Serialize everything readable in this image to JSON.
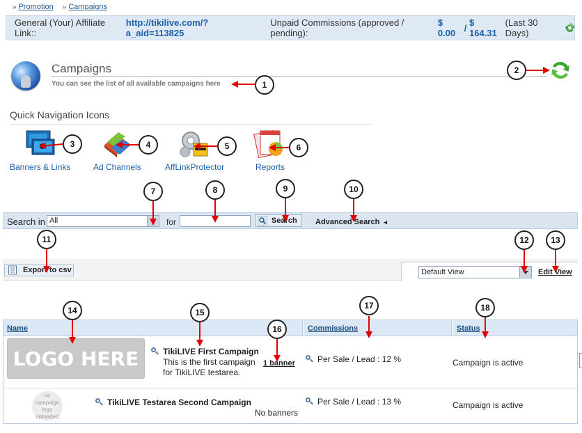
{
  "breadcrumb": [
    {
      "sep": "»",
      "label": "Promotion"
    },
    {
      "sep": "»",
      "label": "Campaigns"
    }
  ],
  "affiliate_bar": {
    "link_label": "General (Your) Affiliate Link::",
    "link_value": "http://tikilive.com/?a_aid=113825",
    "commissions_label": "Unpaid Commissions (approved / pending):",
    "approved": "$ 0.00",
    "divider": "/",
    "pending": "$ 164.31",
    "period": "(Last 30 Days)"
  },
  "section": {
    "title": "Campaigns",
    "subtitle": "You can see the list of all available campaigns here"
  },
  "quick_nav": {
    "title": "Quick Navigation Icons",
    "items": [
      {
        "label": "Banners & Links",
        "icon": "banners-links-icon"
      },
      {
        "label": "Ad Channels",
        "icon": "ad-channels-icon"
      },
      {
        "label": "AffLinkProtector",
        "icon": "afflinkprotector-icon"
      },
      {
        "label": "Reports",
        "icon": "reports-icon"
      }
    ]
  },
  "search": {
    "label": "Search in",
    "selected": "All",
    "for_label": "for",
    "query": "",
    "button": "Search",
    "advanced": "Advanced Search",
    "advanced_arrow": "◂"
  },
  "toolbar": {
    "export": "Export to csv",
    "view_selected": "Default View",
    "edit_view": "Edit View"
  },
  "table": {
    "headers": [
      "Name",
      "Commissions",
      "Status"
    ],
    "rows": [
      {
        "logo": "LOGO HERE",
        "name": "TikiLIVE First Campaign",
        "description": "This is the first campaign for TikiLIVE testarea.",
        "banners": "1 banner",
        "commission": "Per Sale / Lead : 12 %",
        "status": "Campaign is active"
      },
      {
        "logo": "no campaign logo uploaded",
        "name": "TikiLIVE Testarea Second Campaign",
        "description": "",
        "banners": "No banners",
        "commission": "Per Sale / Lead : 13 %",
        "status": "Campaign is active"
      }
    ]
  },
  "callouts": [
    "1",
    "2",
    "3",
    "4",
    "5",
    "6",
    "7",
    "8",
    "9",
    "10",
    "11",
    "12",
    "13",
    "14",
    "15",
    "16",
    "17",
    "18"
  ],
  "colors": {
    "arrow": "#e00000",
    "link_blue": "#1b5fa8",
    "bar_blue": "#dae5f1",
    "refresh_green": "#3aa52f"
  }
}
